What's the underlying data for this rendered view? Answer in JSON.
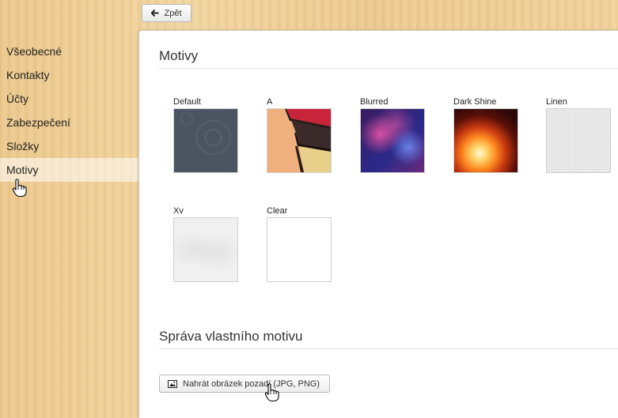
{
  "toolbar": {
    "back_label": "Zpět"
  },
  "sidebar": {
    "items": [
      {
        "label": "Všeobecné"
      },
      {
        "label": "Kontakty"
      },
      {
        "label": "Účty"
      },
      {
        "label": "Zabezpečení"
      },
      {
        "label": "Složky"
      },
      {
        "label": "Motivy"
      }
    ],
    "active": "Motivy"
  },
  "main": {
    "themes_title": "Motivy",
    "themes": [
      {
        "label": "Default",
        "icon": "theme-default-thumbnail"
      },
      {
        "label": "A",
        "icon": "theme-a-thumbnail"
      },
      {
        "label": "Blurred",
        "icon": "theme-blurred-thumbnail"
      },
      {
        "label": "Dark Shine",
        "icon": "theme-dark-shine-thumbnail"
      },
      {
        "label": "Linen",
        "icon": "theme-linen-thumbnail"
      },
      {
        "label": "Xv",
        "icon": "theme-xv-thumbnail"
      },
      {
        "label": "Clear",
        "icon": "theme-clear-thumbnail"
      }
    ],
    "custom_title": "Správa vlastního motivu",
    "upload_label": "Nahrát obrázek pozadí (JPG, PNG)"
  },
  "colors": {
    "sidebar_bg": "#f0d29c",
    "active_item": "#f8ecd6"
  }
}
